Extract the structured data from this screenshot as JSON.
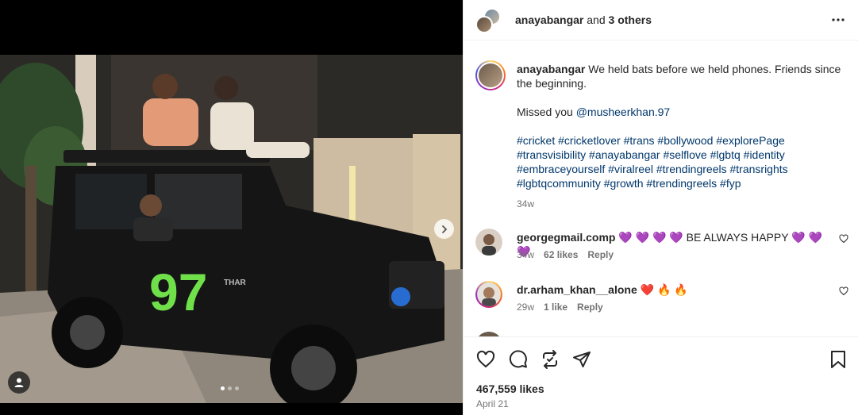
{
  "post": {
    "header": {
      "username": "anayabangar",
      "connector": " and ",
      "others": "3 others"
    },
    "caption": {
      "username": "anayabangar",
      "line1": " We held bats before we held phones. Friends since the beginning.",
      "missed_prefix": "Missed you ",
      "mention": "@musheerkhan.97",
      "hashtags": [
        "#cricket",
        "#cricketlover",
        "#trans",
        "#bollywood",
        "#explorePage",
        "#transvisibility",
        "#anayabangar",
        "#selflove",
        "#lgbtq",
        "#identity",
        "#embraceyourself",
        "#viralreel",
        "#trendingreels",
        "#transrights",
        "#lgbtqcommunity",
        "#growth",
        "#trendingreels",
        "#fyp"
      ],
      "time": "34w"
    },
    "comments": [
      {
        "username": "georgegmail.comp",
        "text": " 💜 💜 💜 💜 BE ALWAYS HAPPY 💜 💜 💜",
        "time": "34w",
        "likes": "62 likes",
        "reply": "Reply"
      },
      {
        "username": "dr.arham_khan__alone",
        "text": " ❤️ 🔥 🔥",
        "time": "29w",
        "likes": "1 like",
        "reply": "Reply"
      }
    ],
    "likes": "467,559 likes",
    "date": "April 21",
    "media": {
      "jeep_number": "97",
      "jeep_badge": "THAR"
    }
  }
}
